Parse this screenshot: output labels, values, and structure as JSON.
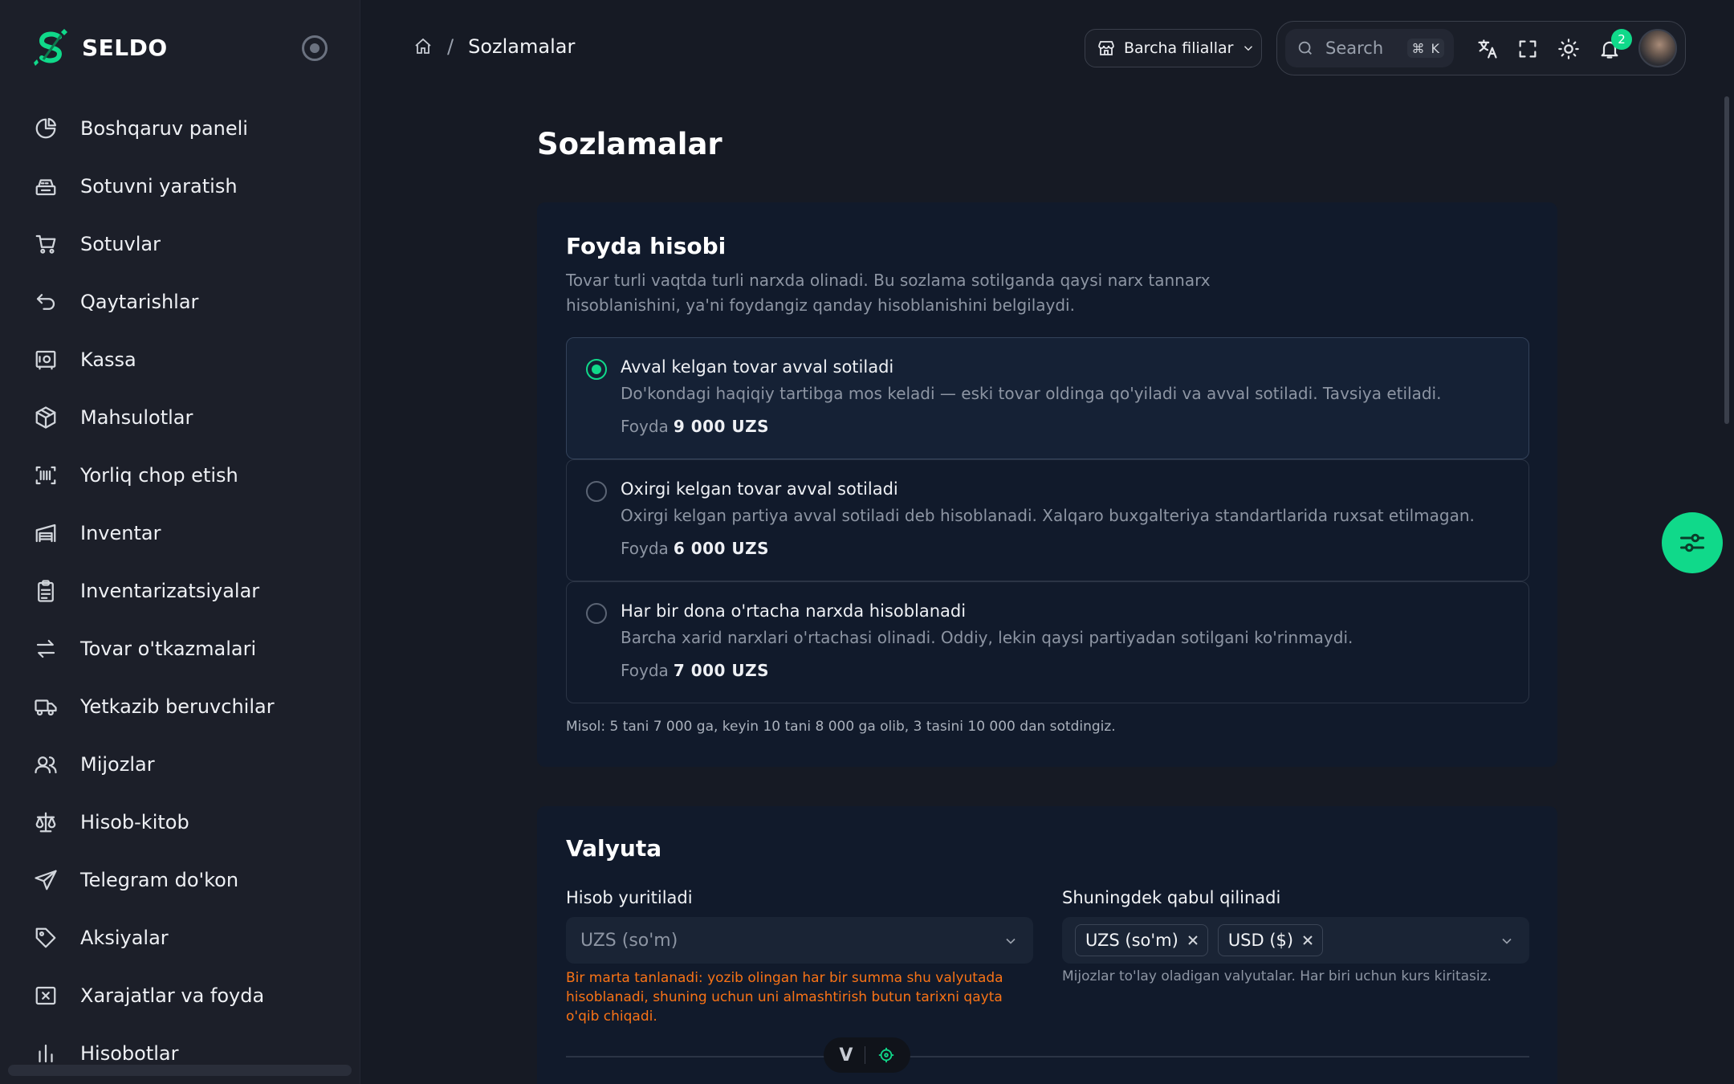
{
  "app": {
    "name": "SELDO"
  },
  "sidebar": {
    "items": [
      {
        "label": "Boshqaruv paneli",
        "icon": "pie-chart-icon"
      },
      {
        "label": "Sotuvni yaratish",
        "icon": "cash-register-icon"
      },
      {
        "label": "Sotuvlar",
        "icon": "shopping-cart-icon"
      },
      {
        "label": "Qaytarishlar",
        "icon": "return-arrow-icon"
      },
      {
        "label": "Kassa",
        "icon": "safe-icon"
      },
      {
        "label": "Mahsulotlar",
        "icon": "box-icon"
      },
      {
        "label": "Yorliq chop etish",
        "icon": "barcode-scan-icon"
      },
      {
        "label": "Inventar",
        "icon": "warehouse-icon"
      },
      {
        "label": "Inventarizatsiyalar",
        "icon": "clipboard-icon"
      },
      {
        "label": "Tovar o'tkazmalari",
        "icon": "transfer-arrows-icon"
      },
      {
        "label": "Yetkazib beruvchilar",
        "icon": "truck-icon"
      },
      {
        "label": "Mijozlar",
        "icon": "users-icon"
      },
      {
        "label": "Hisob-kitob",
        "icon": "scale-icon"
      },
      {
        "label": "Telegram do'kon",
        "icon": "send-icon"
      },
      {
        "label": "Aksiyalar",
        "icon": "tag-icon"
      },
      {
        "label": "Xarajatlar va foyda",
        "icon": "expense-icon"
      },
      {
        "label": "Hisobotlar",
        "icon": "report-icon"
      }
    ]
  },
  "header": {
    "breadcrumb_current": "Sozlamalar",
    "branch_label": "Barcha filiallar",
    "search_placeholder": "Search",
    "shortcut_symbol": "⌘",
    "shortcut_key": "K",
    "notification_count": "2"
  },
  "page": {
    "title": "Sozlamalar"
  },
  "profit": {
    "title": "Foyda hisobi",
    "description": "Tovar turli vaqtda turli narxda olinadi. Bu sozlama sotilganda qaysi narx tannarx hisoblanishini, ya'ni foydangiz qanday hisoblanishini belgilaydi.",
    "options": [
      {
        "title": "Avval kelgan tovar avval sotiladi",
        "description": "Do'kondagi haqiqiy tartibga mos keladi — eski tovar oldinga qo'yiladi va avval sotiladi. Tavsiya etiladi.",
        "profit_label": "Foyda",
        "profit_value": "9 000 UZS",
        "selected": true
      },
      {
        "title": "Oxirgi kelgan tovar avval sotiladi",
        "description": "Oxirgi kelgan partiya avval sotiladi deb hisoblanadi. Xalqaro buxgalteriya standartlarida ruxsat etilmagan.",
        "profit_label": "Foyda",
        "profit_value": "6 000 UZS",
        "selected": false
      },
      {
        "title": "Har bir dona o'rtacha narxda hisoblanadi",
        "description": "Barcha xarid narxlari o'rtachasi olinadi. Oddiy, lekin qaysi partiyadan sotilgani ko'rinmaydi.",
        "profit_label": "Foyda",
        "profit_value": "7 000 UZS",
        "selected": false
      }
    ],
    "example": "Misol: 5 tani 7 000 ga, keyin 10 tani 8 000 ga olib, 3 tasini 10 000 dan sotdingiz."
  },
  "currency": {
    "title": "Valyuta",
    "base_label": "Hisob yuritiladi",
    "base_value": "UZS (so'm)",
    "base_warning": "Bir marta tanlanadi: yozib olingan har bir summa shu valyutada hisoblanadi, shuning uchun uni almashtirish butun tarixni qayta o'qib chiqadi.",
    "accepted_label": "Shuningdek qabul qilinadi",
    "accepted_values": [
      "UZS (so'm)",
      "USD ($)"
    ],
    "accepted_hint": "Mijozlar to'lay oladigan valyutalar. Har biri uchun kurs kiritasiz."
  },
  "devtools": {
    "label": "V"
  },
  "colors": {
    "accent": "#10d98a",
    "background": "#161a24",
    "sidebar": "#1c1f29",
    "card": "#111a2b",
    "warning": "#f97316"
  }
}
